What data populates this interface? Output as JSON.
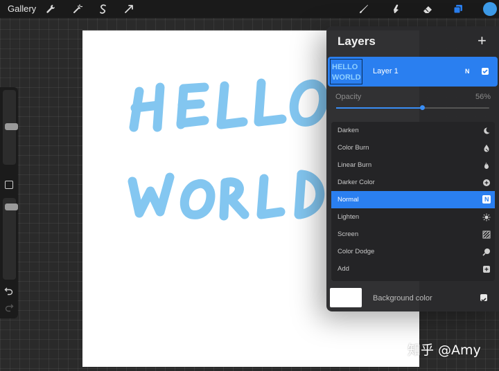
{
  "topbar": {
    "gallery_label": "Gallery",
    "icons": [
      "wrench-icon",
      "magic-wand-icon",
      "selection-icon",
      "transform-arrow-icon",
      "brush-icon",
      "smudge-icon",
      "eraser-icon",
      "layers-icon",
      "color-picker-icon"
    ],
    "active_color": "#3d9be9"
  },
  "canvas": {
    "drawn_text_lines": [
      "HELLO",
      "WORLD"
    ],
    "stroke_color": "#7dc4f0"
  },
  "layers_panel": {
    "title": "Layers",
    "layer": {
      "name": "Layer 1",
      "blend_badge": "N",
      "visible": true,
      "thumbnail_text": [
        "HELLO",
        "WORLD"
      ]
    },
    "opacity": {
      "label": "Opacity",
      "value_text": "56%",
      "value": 0.56
    },
    "blend_modes": [
      {
        "label": "Darken",
        "icon": "crescent-icon",
        "selected": false
      },
      {
        "label": "Color Burn",
        "icon": "burn-icon",
        "selected": false
      },
      {
        "label": "Linear Burn",
        "icon": "flame-icon",
        "selected": false
      },
      {
        "label": "Darker Color",
        "icon": "plus-circle-icon",
        "selected": false
      },
      {
        "label": "Normal",
        "icon": "n-badge-icon",
        "badge": "N",
        "selected": true
      },
      {
        "label": "Lighten",
        "icon": "sun-icon",
        "selected": false
      },
      {
        "label": "Screen",
        "icon": "hatch-icon",
        "selected": false
      },
      {
        "label": "Color Dodge",
        "icon": "dodge-icon",
        "selected": false
      },
      {
        "label": "Add",
        "icon": "plus-square-icon",
        "selected": false
      }
    ],
    "background": {
      "label": "Background color",
      "color": "#ffffff",
      "visible": true
    }
  },
  "watermark": "知乎 @Amy",
  "colors": {
    "accent": "#2a7ff0",
    "panel": "#2a2a2c",
    "topbar": "#1a1a1a"
  }
}
